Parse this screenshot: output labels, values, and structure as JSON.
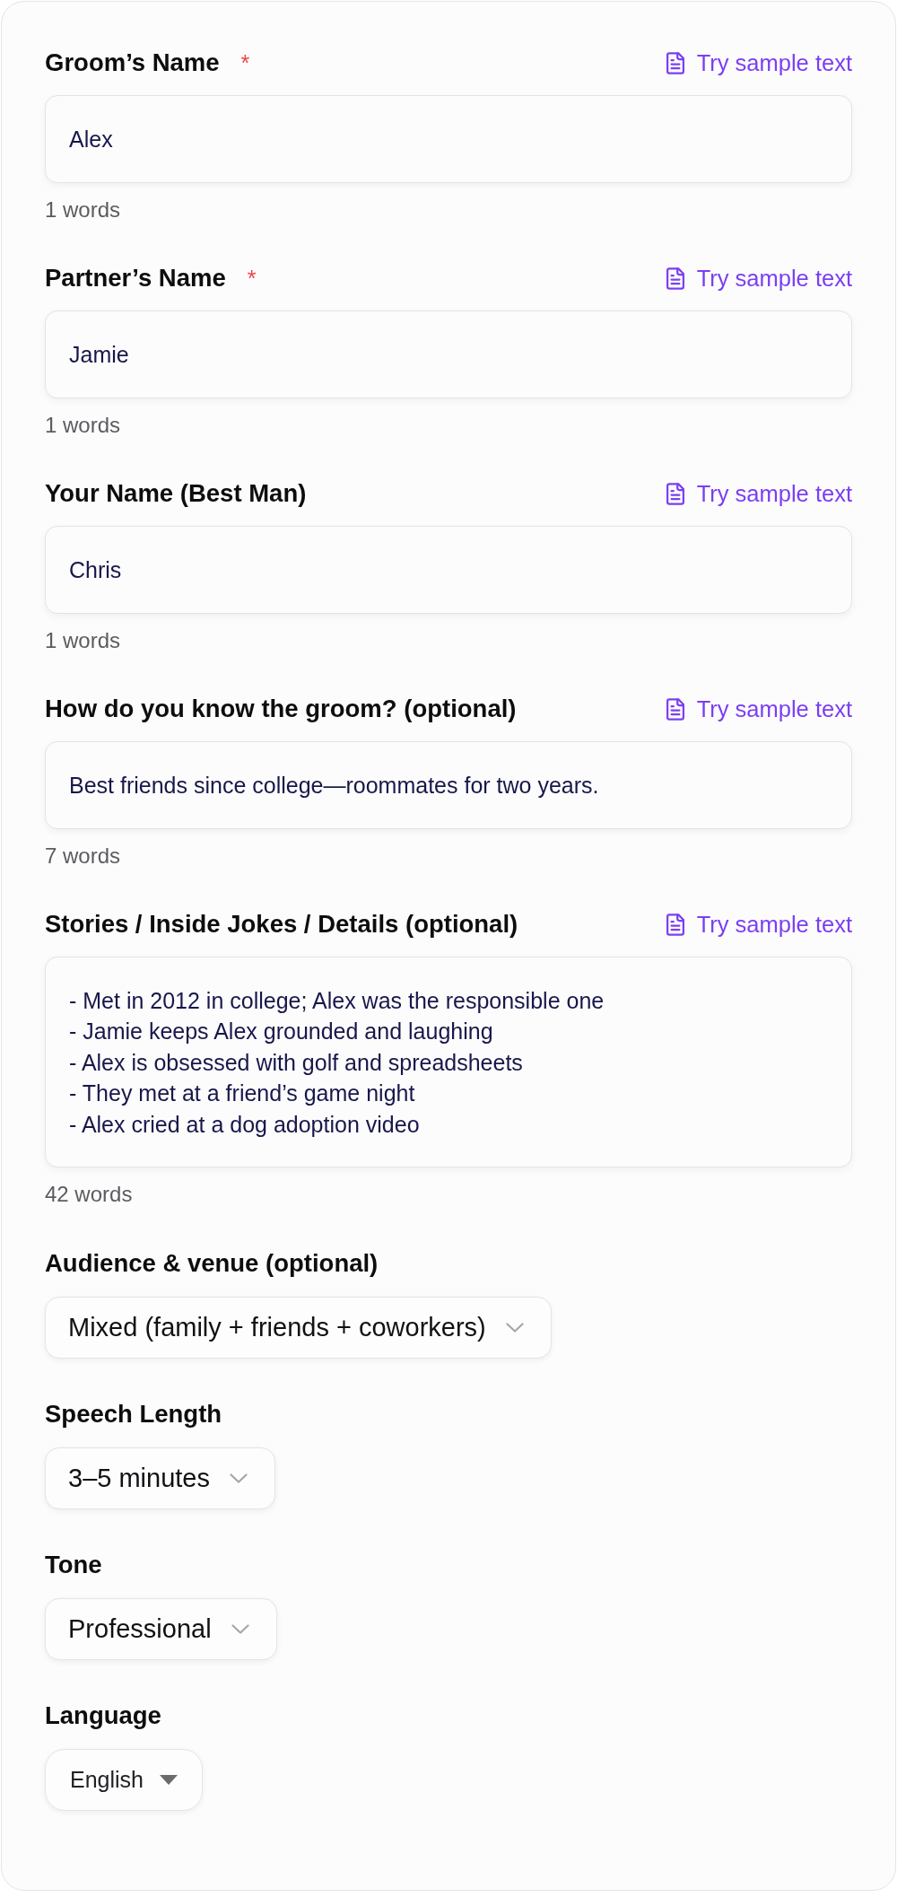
{
  "fields": [
    {
      "kind": "input",
      "label": "Groom’s Name",
      "required_mark": "*",
      "sample_button": "Try sample text",
      "value": "Alex",
      "word_count": "1 words"
    },
    {
      "kind": "input",
      "label": "Partner’s Name",
      "required_mark": "*",
      "sample_button": "Try sample text",
      "value": "Jamie",
      "word_count": "1 words"
    },
    {
      "kind": "input",
      "label": "Your Name (Best Man)",
      "sample_button": "Try sample text",
      "value": "Chris",
      "word_count": "1 words"
    },
    {
      "kind": "input",
      "label": "How do you know the groom? (optional)",
      "sample_button": "Try sample text",
      "value": "Best friends since college—roommates for two years.",
      "word_count": "7 words"
    },
    {
      "kind": "textarea",
      "label": "Stories / Inside Jokes / Details (optional)",
      "sample_button": "Try sample text",
      "value": "- Met in 2012 in college; Alex was the responsible one\n- Jamie keeps Alex grounded and laughing\n- Alex is obsessed with golf and spreadsheets\n- They met at a friend’s game night\n- Alex cried at a dog adoption video",
      "word_count": "42 words"
    }
  ],
  "dropdowns": [
    {
      "kind": "styled",
      "label": "Audience & venue (optional)",
      "value": "Mixed (family + friends + coworkers)"
    },
    {
      "kind": "styled",
      "label": "Speech Length",
      "value": "3–5 minutes"
    },
    {
      "kind": "styled",
      "label": "Tone",
      "value": "Professional"
    },
    {
      "kind": "native",
      "label": "Language",
      "value": "English"
    }
  ]
}
